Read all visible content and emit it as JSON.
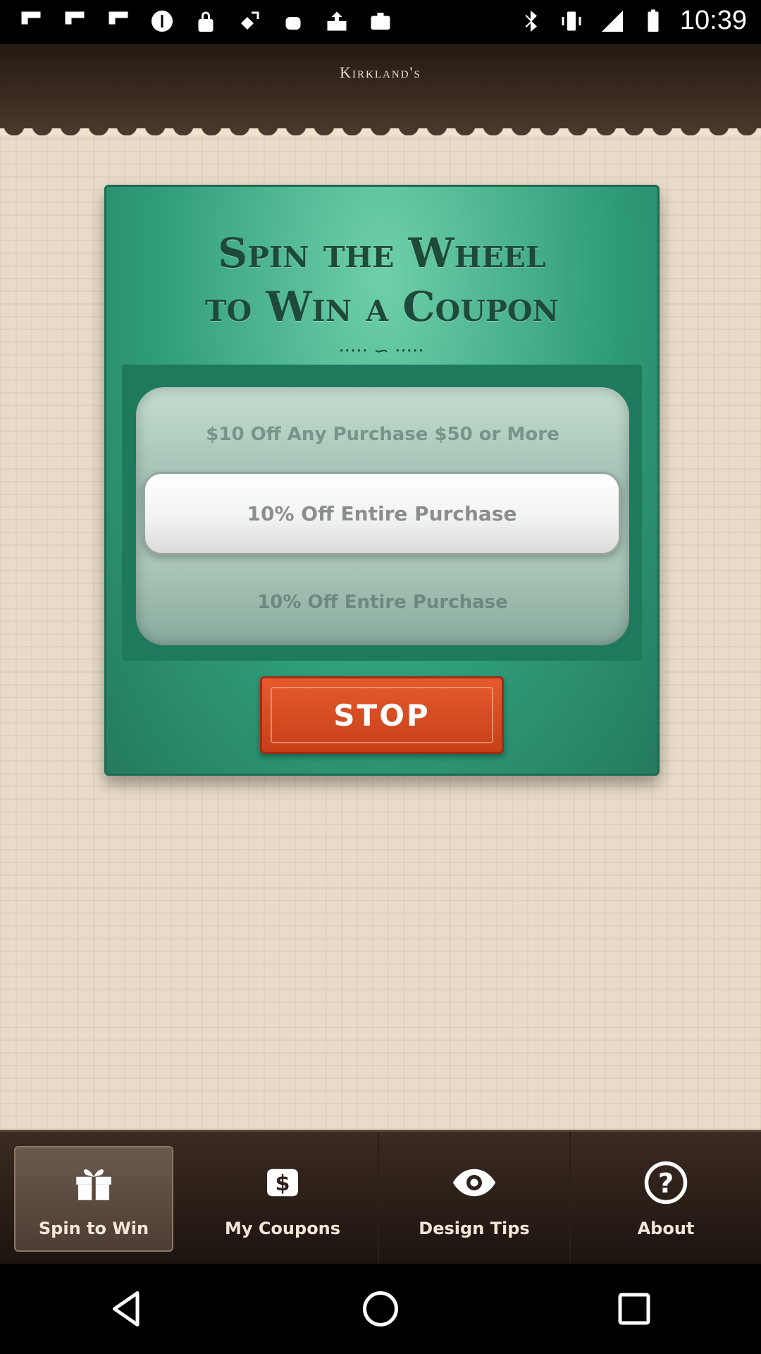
{
  "status_bar": {
    "time": "10:39",
    "left_icons": [
      "flipboard-icon",
      "flipboard-icon",
      "flipboard-icon",
      "info-icon",
      "lock-icon",
      "satellite-icon",
      "android-icon",
      "download-box-icon",
      "briefcase-icon"
    ],
    "right_icons": [
      "bluetooth-icon",
      "vibrate-icon",
      "signal-icon",
      "battery-icon"
    ]
  },
  "header": {
    "brand": "Kirkland's"
  },
  "promo": {
    "title_line1": "Spin the Wheel",
    "title_line2": "to Win a Coupon",
    "wheel_items": {
      "top": "$10 Off Any Purchase $50 or More",
      "selected": "10% Off Entire Purchase",
      "bottom": "10% Off Entire Purchase"
    },
    "stop_label": "STOP"
  },
  "tabs": [
    {
      "label": "Spin to Win",
      "icon": "gift-icon",
      "active": true
    },
    {
      "label": "My Coupons",
      "icon": "dollar-tag-icon",
      "active": false
    },
    {
      "label": "Design Tips",
      "icon": "eye-icon",
      "active": false
    },
    {
      "label": "About",
      "icon": "question-circle-icon",
      "active": false
    }
  ],
  "nav": [
    "back-icon",
    "home-icon",
    "recents-icon"
  ],
  "colors": {
    "card_green": "#2f9b79",
    "stop_orange": "#d94b22",
    "tab_bar_brown": "#2e221b"
  }
}
